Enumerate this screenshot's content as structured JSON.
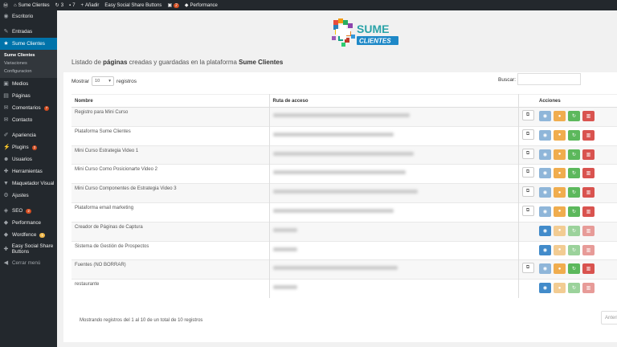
{
  "adminbar": {
    "site_name": "Sume Clientes",
    "updates": "3",
    "comments": "7",
    "new_label": "Añadir",
    "plugin_label": "Easy Social Share Buttons",
    "notif_count": "2",
    "performance_label": "Performance"
  },
  "sidebar": {
    "items": [
      {
        "label": "Escritorio",
        "icon": "dashboard-icon",
        "glyph": "◉"
      },
      {
        "label": "Entradas",
        "icon": "pin-icon",
        "glyph": "✎"
      },
      {
        "label": "Sume Clientes",
        "icon": "star-icon",
        "glyph": "★"
      },
      {
        "label": "Medios",
        "icon": "media-icon",
        "glyph": "▣"
      },
      {
        "label": "Páginas",
        "icon": "pages-icon",
        "glyph": "▤"
      },
      {
        "label": "Comentarios",
        "icon": "comments-icon",
        "glyph": "✉",
        "badge": "7"
      },
      {
        "label": "Contacto",
        "icon": "mail-icon",
        "glyph": "✉"
      },
      {
        "label": "Apariencia",
        "icon": "brush-icon",
        "glyph": "✐"
      },
      {
        "label": "Plugins",
        "icon": "plugin-icon",
        "glyph": "⚡",
        "badge": "3"
      },
      {
        "label": "Usuarios",
        "icon": "users-icon",
        "glyph": "☻"
      },
      {
        "label": "Herramientas",
        "icon": "tools-icon",
        "glyph": "✚"
      },
      {
        "label": "Maquetador Visual",
        "icon": "builder-icon",
        "glyph": "▼"
      },
      {
        "label": "Ajustes",
        "icon": "settings-icon",
        "glyph": "⚙"
      },
      {
        "label": "SEO",
        "icon": "seo-icon",
        "glyph": "◈",
        "badge": "2"
      },
      {
        "label": "Performance",
        "icon": "performance-icon",
        "glyph": "◆"
      },
      {
        "label": "Wordfence",
        "icon": "shield-icon",
        "glyph": "◆",
        "badge": "1"
      },
      {
        "label": "Easy Social Share Buttons",
        "icon": "share-icon",
        "glyph": "✚"
      },
      {
        "label": "Cerrar menú",
        "icon": "collapse-icon",
        "glyph": "◀"
      }
    ],
    "submenu": [
      "Sume Clientes",
      "Variaciones",
      "Configuracion"
    ]
  },
  "logo": {
    "line1": "SUME",
    "line2": "CLIENTES"
  },
  "heading": {
    "prefix": "Listado de",
    "bold1": "páginas",
    "middle": "creadas y guardadas en la plataforma",
    "bold2": "Sume Clientes"
  },
  "table_controls": {
    "show_label": "Mostrar",
    "show_value": "10",
    "records_label": "registros",
    "search_label": "Buscar:"
  },
  "columns": {
    "name": "Nombre",
    "path": "Ruta de acceso",
    "actions": "Acciones"
  },
  "rows": [
    {
      "name": "Registro para Mini Curso",
      "copy": true,
      "light": false
    },
    {
      "name": "Plataforma Sume Clientes",
      "copy": true,
      "light": false
    },
    {
      "name": "Mini Curso Estrategia Video 1",
      "copy": true,
      "light": false
    },
    {
      "name": "Mini Curso Como Posicionarte Video 2",
      "copy": true,
      "light": false
    },
    {
      "name": "Mini Curso Componentes de Estrategia Video 3",
      "copy": true,
      "light": false
    },
    {
      "name": "Plataforma email marketing",
      "copy": true,
      "light": false
    },
    {
      "name": "Creador de Páginas de Captura",
      "copy": false,
      "light": true
    },
    {
      "name": "Sistema de Gestión de Prospectos",
      "copy": false,
      "light": true
    },
    {
      "name": "Fuentes (NO BORRAR)",
      "copy": true,
      "light": false
    },
    {
      "name": "restaurante",
      "copy": false,
      "light": true
    }
  ],
  "footer": {
    "info": "Mostrando registros del 1 al 10 de un total de 10 registros",
    "prev": "Anterior"
  },
  "colors": {
    "accent": "#0073aa",
    "view": "#428bca",
    "edit": "#f0ad4e",
    "sync": "#5cb85c",
    "delete": "#d9534f"
  }
}
